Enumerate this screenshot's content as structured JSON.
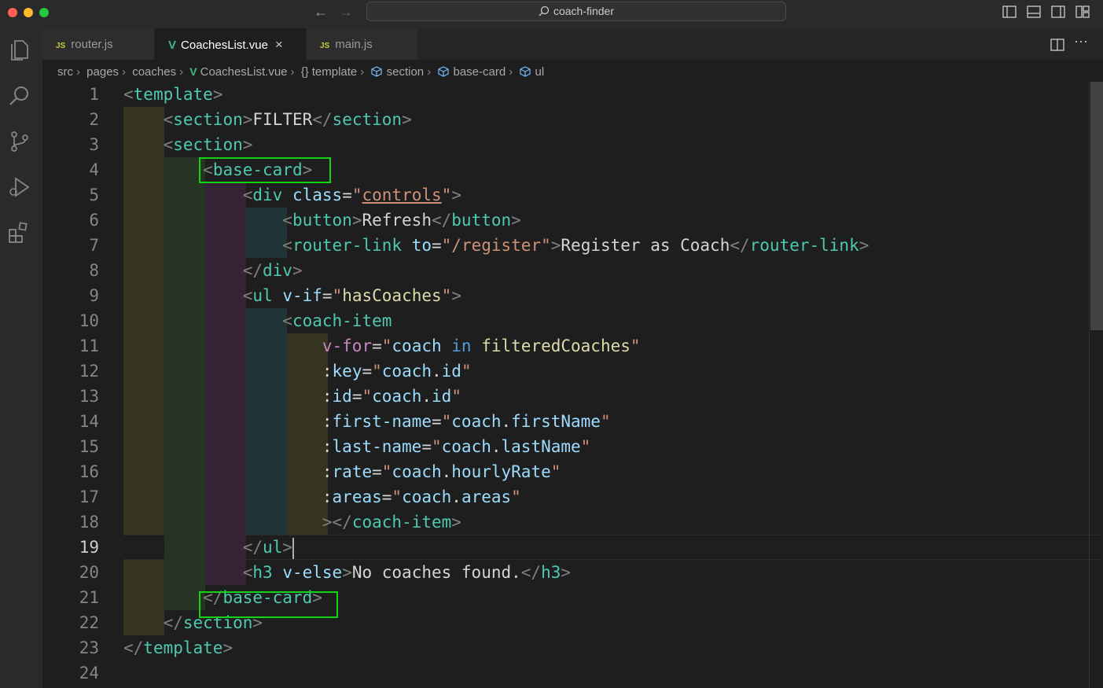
{
  "window": {
    "title": "coach-finder"
  },
  "colors": {
    "highlight": "#14d314",
    "tab_active_bg": "#1e1e1e",
    "editor_bg": "#1e1e1e"
  },
  "activity_bar": [
    "explorer-icon",
    "search-icon",
    "source-control-icon",
    "run-debug-icon",
    "extensions-icon"
  ],
  "tabs": [
    {
      "label": "router.js",
      "icon": "JS",
      "active": false
    },
    {
      "label": "CoachesList.vue",
      "icon": "vue-icon",
      "active": true,
      "close": "×"
    },
    {
      "label": "main.js",
      "icon": "JS",
      "active": false
    }
  ],
  "breadcrumb": {
    "items": [
      "src",
      "pages",
      "coaches",
      "CoachesList.vue",
      "template",
      "section",
      "base-card",
      "ul"
    ],
    "template_icon": "{}"
  },
  "editor": {
    "current_line": 19,
    "lines": [
      {
        "n": "1"
      },
      {
        "n": "2"
      },
      {
        "n": "3"
      },
      {
        "n": "4"
      },
      {
        "n": "5"
      },
      {
        "n": "6"
      },
      {
        "n": "7"
      },
      {
        "n": "8"
      },
      {
        "n": "9"
      },
      {
        "n": "10"
      },
      {
        "n": "11"
      },
      {
        "n": "12"
      },
      {
        "n": "13"
      },
      {
        "n": "14"
      },
      {
        "n": "15"
      },
      {
        "n": "16"
      },
      {
        "n": "17"
      },
      {
        "n": "18"
      },
      {
        "n": "19"
      },
      {
        "n": "20"
      },
      {
        "n": "21"
      },
      {
        "n": "22"
      },
      {
        "n": "23"
      },
      {
        "n": "24"
      }
    ],
    "tokens": {
      "lt": "<",
      "gt": ">",
      "lt_slash": "</",
      "eq": "=",
      "q": "\"",
      "colon": ":",
      "dot": ".",
      "template": "template",
      "section": "section",
      "base_card": "base-card",
      "div": "div",
      "button": "button",
      "router_link": "router-link",
      "ul": "ul",
      "coach_item": "coach-item",
      "h3": "h3",
      "filter": "FILTER",
      "class": "class",
      "controls": "controls",
      "refresh": "Refresh",
      "to": "to",
      "register_path": "/register",
      "register_text": "Register as Coach",
      "v_if": "v-if",
      "has_coaches": "hasCoaches",
      "v_for": "v-for",
      "coach": "coach",
      "in": "in",
      "filtered_coaches": "filteredCoaches",
      "key": "key",
      "id": "id",
      "first_name_attr": "first-name",
      "first_name": "firstName",
      "last_name_attr": "last-name",
      "last_name": "lastName",
      "rate": "rate",
      "hourly_rate": "hourlyRate",
      "areas": "areas",
      "v_else": "v-else",
      "no_coaches": "No coaches found."
    }
  }
}
